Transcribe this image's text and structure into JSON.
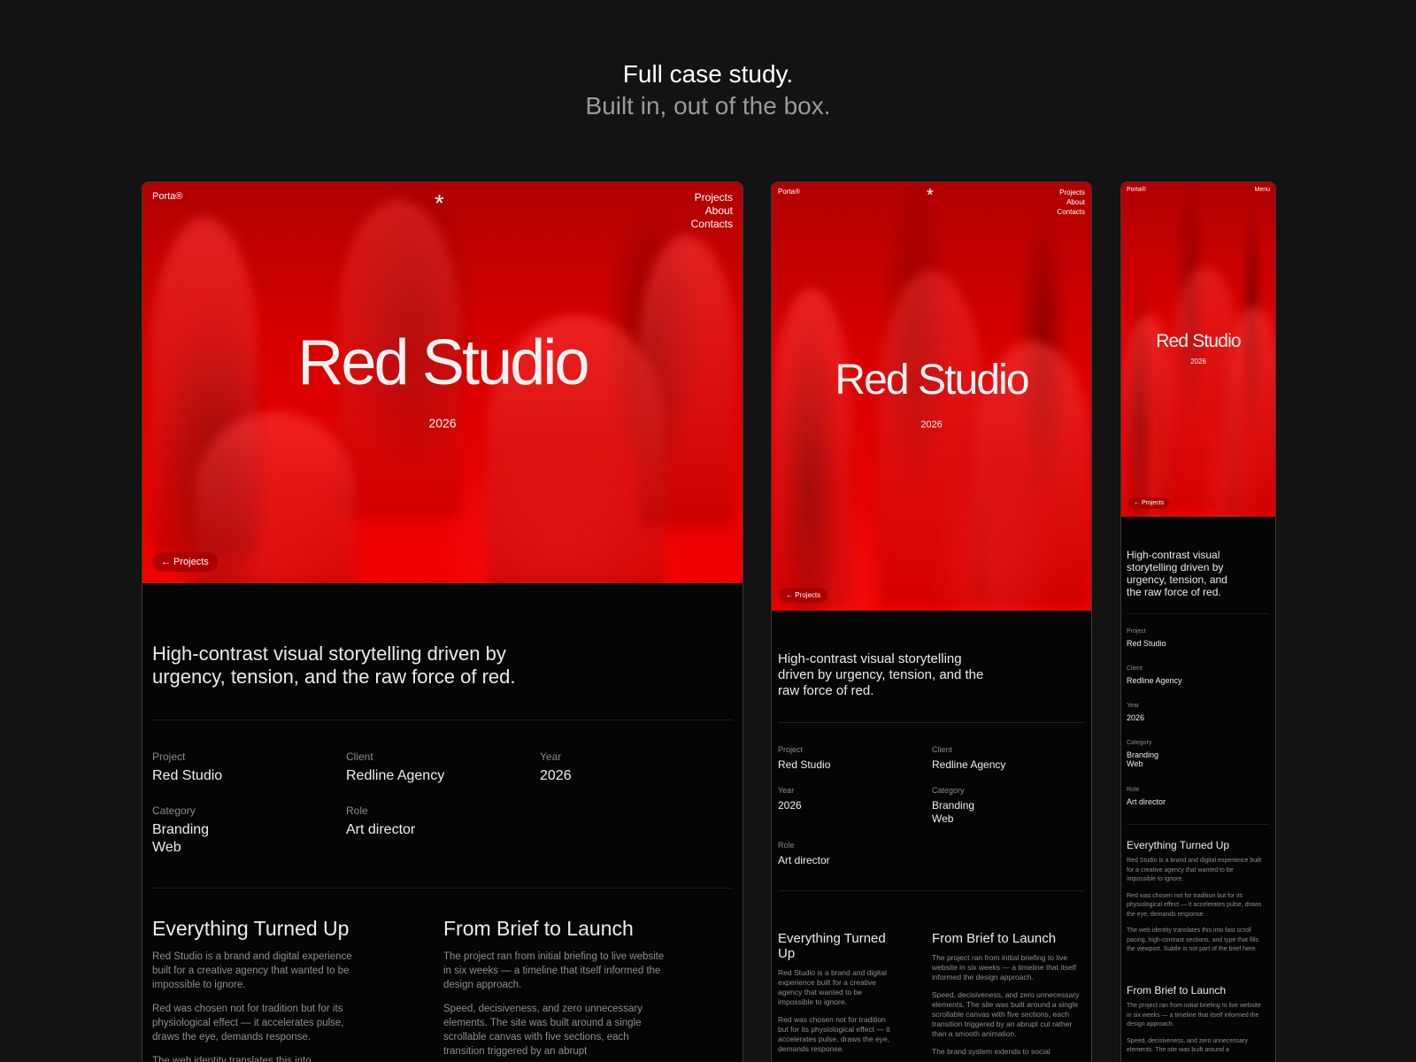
{
  "headline": {
    "line1": "Full case study.",
    "line2": "Built in, out of the box."
  },
  "site": {
    "brand": "Porta®",
    "asterisk": "*",
    "nav": [
      "Projects",
      "About",
      "Contacts"
    ],
    "menu": "Menu",
    "title": "Red Studio",
    "year": "2026",
    "back": "← Projects",
    "lead": "High-contrast visual storytelling driven by urgency, tension, and the raw force of red.",
    "meta": {
      "project_label": "Project",
      "project": "Red Studio",
      "client_label": "Client",
      "client": "Redline Agency",
      "year_label": "Year",
      "year": "2026",
      "category_label": "Category",
      "category1": "Branding",
      "category2": "Web",
      "role_label": "Role",
      "role": "Art director"
    },
    "sec1": {
      "title": "Everything Turned Up",
      "p1": "Red Studio is a brand and digital experience built for a creative agency that wanted to be impossible to ignore.",
      "p2": "Red was chosen not for tradition but for its physiological effect — it accelerates pulse, draws the eye, demands response.",
      "p3": "The web identity translates this into",
      "p3_full": "The web identity translates this into fast scroll pacing, high-contrast sections, and type that fills the viewport. Subtle is not part of the brief here."
    },
    "sec2": {
      "title": "From Brief to Launch",
      "p1": "The project ran from initial briefing to live website in six weeks — a timeline that itself informed the design approach.",
      "p2": "Speed, decisiveness, and zero unnecessary elements. The site was built around a single scrollable canvas with five sections, each transition triggered by an abrupt",
      "p2_tablet": "Speed, decisiveness, and zero unnecessary elements. The site was built around a single scrollable canvas with five sections, each transition triggered by an abrupt cut rather than a smooth animation.",
      "p2_mobile": "Speed, decisiveness, and zero unnecessary elements. The site was built around a",
      "p3": "The brand system extends to social"
    }
  }
}
